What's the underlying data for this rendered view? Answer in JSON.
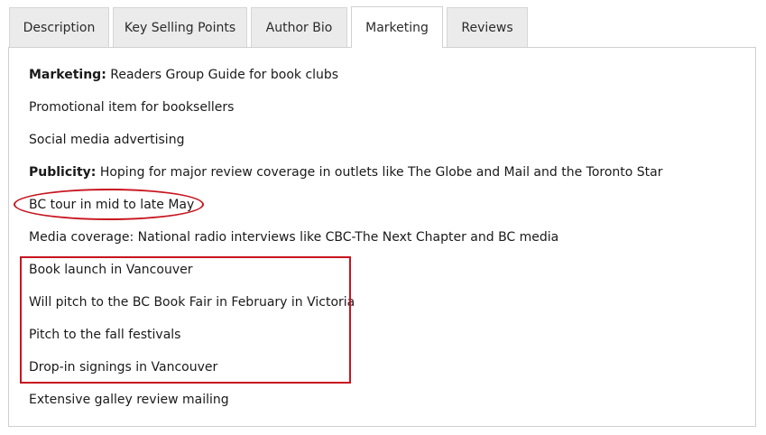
{
  "tabs": [
    {
      "label": "Description"
    },
    {
      "label": "Key Selling Points"
    },
    {
      "label": "Author Bio"
    },
    {
      "label": "Marketing"
    },
    {
      "label": "Reviews"
    }
  ],
  "active_tab": "Marketing",
  "panel": {
    "lines": [
      {
        "bold": "Marketing:",
        "text": " Readers Group Guide for book clubs"
      },
      {
        "bold": "",
        "text": "Promotional item for booksellers"
      },
      {
        "bold": "",
        "text": "Social media advertising"
      },
      {
        "bold": "Publicity:",
        "text": " Hoping for major review coverage in outlets like The Globe and Mail and the Toronto Star"
      },
      {
        "bold": "",
        "text": "BC tour in mid to late May"
      },
      {
        "bold": "",
        "text": "Media coverage: National radio interviews like CBC-The Next Chapter and BC media"
      },
      {
        "bold": "",
        "text": "Book launch in Vancouver"
      },
      {
        "bold": "",
        "text": "Will pitch to the BC Book Fair in February in Victoria"
      },
      {
        "bold": "",
        "text": "Pitch to the fall festivals"
      },
      {
        "bold": "",
        "text": "Drop-in signings in Vancouver"
      },
      {
        "bold": "",
        "text": "Extensive galley review mailing"
      }
    ]
  },
  "annotation_color": "#c8141e"
}
